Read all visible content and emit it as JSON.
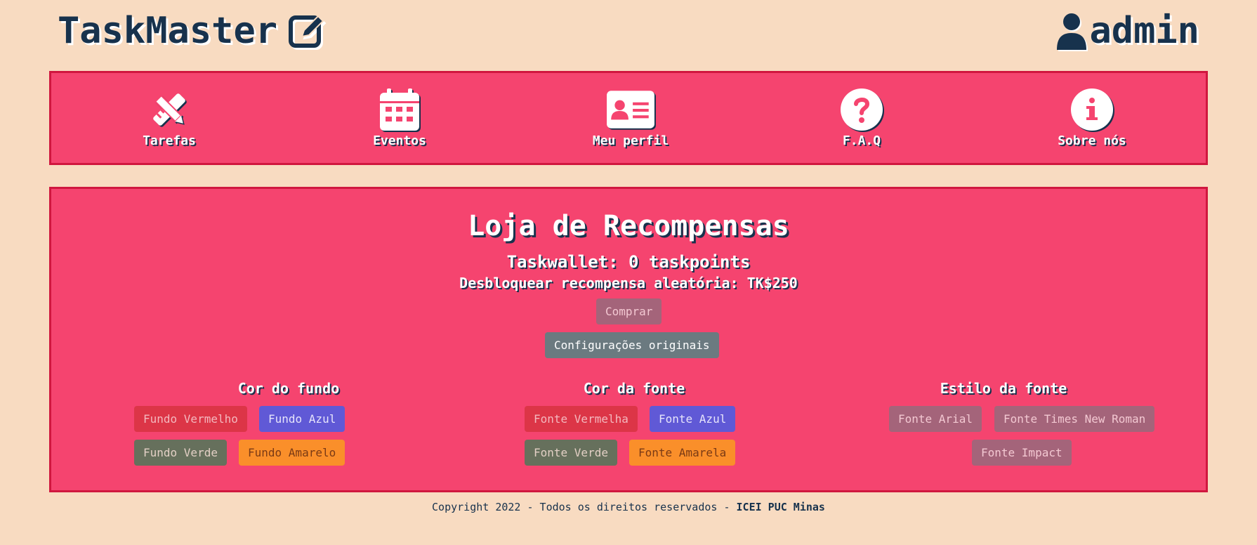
{
  "header": {
    "brand": "TaskMaster",
    "brand_icon": "edit-icon",
    "user": "admin",
    "user_icon": "user-icon"
  },
  "nav": {
    "items": [
      {
        "label": "Tarefas",
        "icon": "pencil-ruler-icon"
      },
      {
        "label": "Eventos",
        "icon": "calendar-icon"
      },
      {
        "label": "Meu perfil",
        "icon": "id-card-icon"
      },
      {
        "label": "F.A.Q",
        "icon": "question-circle-icon"
      },
      {
        "label": "Sobre nós",
        "icon": "info-circle-icon"
      }
    ]
  },
  "store": {
    "title": "Loja de Recompensas",
    "wallet": "Taskwallet: 0 taskpoints",
    "unlock": "Desbloquear recompensa aleatória: TK$250",
    "buy_label": "Comprar",
    "reset_label": "Configurações originais",
    "groups": {
      "background": {
        "title": "Cor do fundo",
        "buttons": [
          "Fundo Vermelho",
          "Fundo Azul",
          "Fundo Verde",
          "Fundo Amarelo"
        ]
      },
      "font_color": {
        "title": "Cor da fonte",
        "buttons": [
          "Fonte Vermelha",
          "Fonte Azul",
          "Fonte Verde",
          "Fonte Amarela"
        ]
      },
      "font_style": {
        "title": "Estilo da fonte",
        "buttons": [
          "Fonte Arial",
          "Fonte Times New Roman",
          "Fonte Impact"
        ]
      }
    }
  },
  "footer": {
    "text": "Copyright 2022 - Todos os direitos reservados - ",
    "org": "ICEI PUC Minas"
  },
  "colors": {
    "page_bg": "#f8dbc1",
    "panel_bg": "#f5446f",
    "panel_border": "#d0173f",
    "navy": "#17324d"
  }
}
